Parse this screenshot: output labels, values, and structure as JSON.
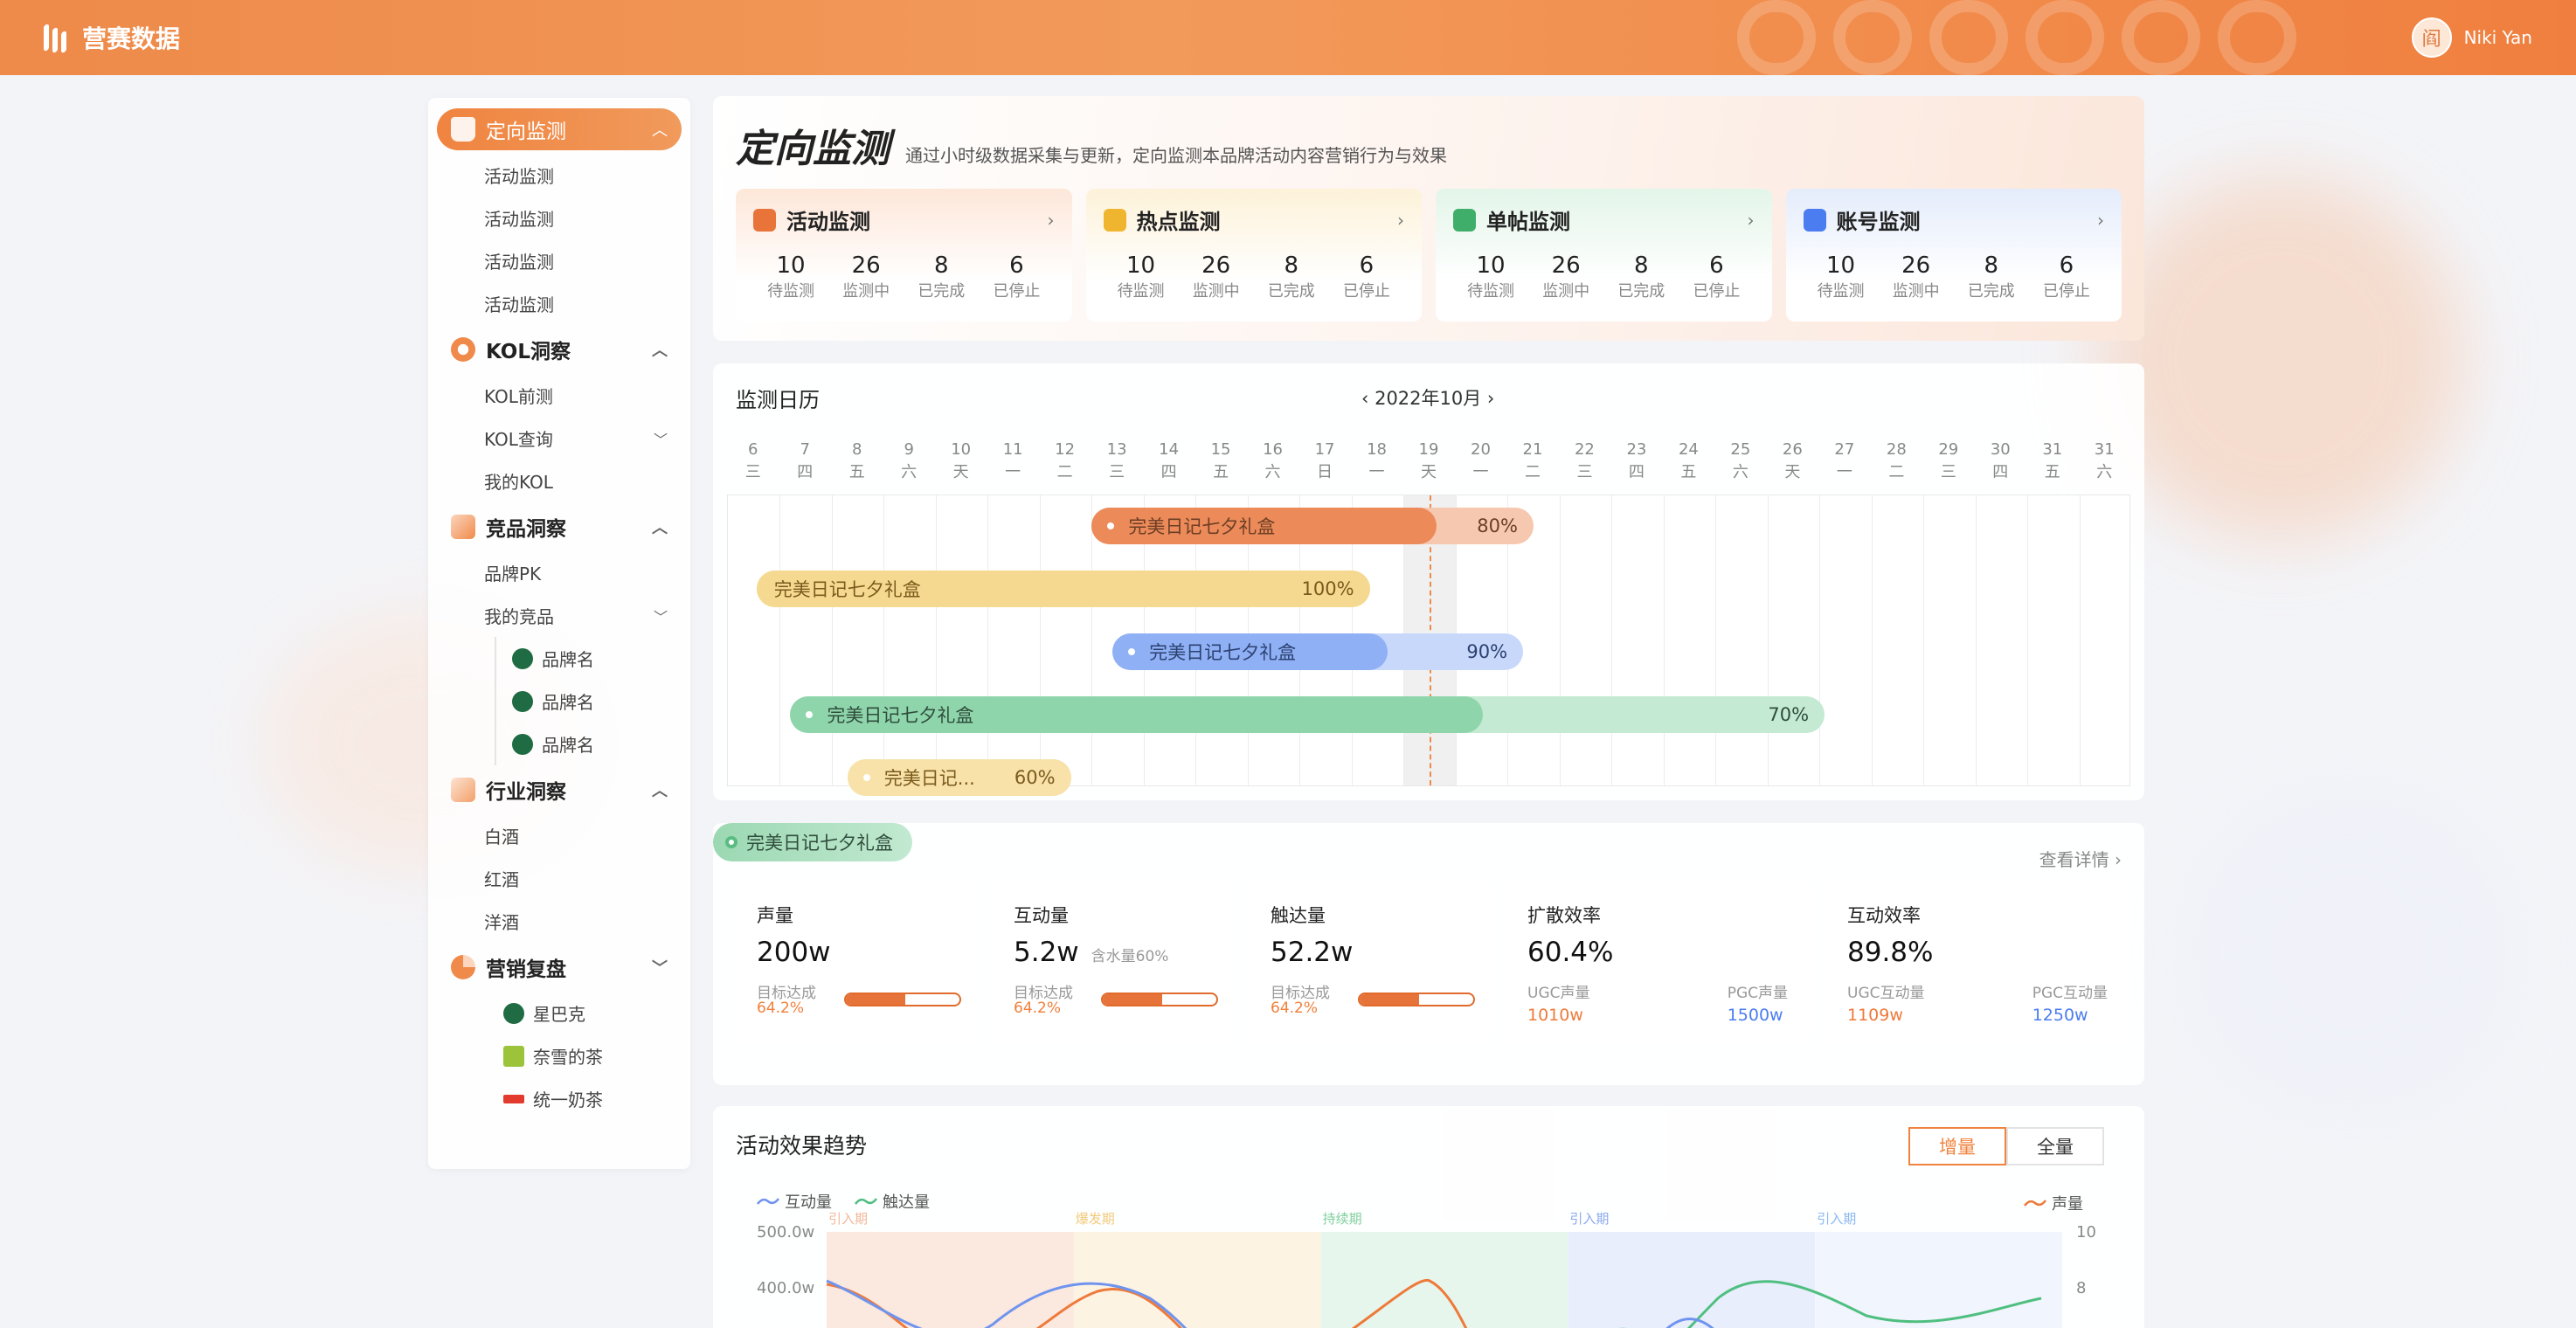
{
  "app": {
    "name": "营赛数据",
    "user": "Niki Yan",
    "avatar_char": "阎"
  },
  "sidebar": {
    "groups": [
      {
        "label": "定向监测",
        "active": true,
        "items": [
          "活动监测",
          "活动监测",
          "活动监测",
          "活动监测"
        ]
      },
      {
        "label": "KOL洞察",
        "items": [
          "KOL前测",
          "KOL查询",
          "我的KOL"
        ]
      },
      {
        "label": "竞品洞察",
        "items": [
          "品牌PK",
          "我的竞品"
        ],
        "brands": [
          "品牌名",
          "品牌名",
          "品牌名"
        ]
      },
      {
        "label": "行业洞察",
        "items": [
          "白酒",
          "红酒",
          "洋酒"
        ]
      },
      {
        "label": "营销复盘",
        "shops": [
          "星巴克",
          "奈雪的茶",
          "统一奶茶"
        ]
      }
    ]
  },
  "hero": {
    "title": "定向监测",
    "subtitle": "通过小时级数据采集与更新，定向监测本品牌活动内容营销行为与效果",
    "cards": [
      {
        "title": "活动监测",
        "color": "#e8743a",
        "values": [
          "10",
          "26",
          "8",
          "6"
        ]
      },
      {
        "title": "热点监测",
        "color": "#f0b52f",
        "values": [
          "10",
          "26",
          "8",
          "6"
        ]
      },
      {
        "title": "单帖监测",
        "color": "#3fae6a",
        "values": [
          "10",
          "26",
          "8",
          "6"
        ]
      },
      {
        "title": "账号监测",
        "color": "#4b7df0",
        "values": [
          "10",
          "26",
          "8",
          "6"
        ]
      }
    ],
    "labels": [
      "待监测",
      "监测中",
      "已完成",
      "已停止"
    ]
  },
  "calendar": {
    "title": "监测日历",
    "month": "2022年10月",
    "days": [
      {
        "d": "6",
        "w": "三"
      },
      {
        "d": "7",
        "w": "四"
      },
      {
        "d": "8",
        "w": "五"
      },
      {
        "d": "9",
        "w": "六"
      },
      {
        "d": "10",
        "w": "天"
      },
      {
        "d": "11",
        "w": "一"
      },
      {
        "d": "12",
        "w": "二"
      },
      {
        "d": "13",
        "w": "三"
      },
      {
        "d": "14",
        "w": "四"
      },
      {
        "d": "15",
        "w": "五"
      },
      {
        "d": "16",
        "w": "六"
      },
      {
        "d": "17",
        "w": "日"
      },
      {
        "d": "18",
        "w": "一"
      },
      {
        "d": "19",
        "w": "天"
      },
      {
        "d": "20",
        "w": "一"
      },
      {
        "d": "21",
        "w": "二"
      },
      {
        "d": "22",
        "w": "三"
      },
      {
        "d": "23",
        "w": "四"
      },
      {
        "d": "24",
        "w": "五"
      },
      {
        "d": "25",
        "w": "六"
      },
      {
        "d": "26",
        "w": "天"
      },
      {
        "d": "27",
        "w": "一"
      },
      {
        "d": "28",
        "w": "二"
      },
      {
        "d": "29",
        "w": "三"
      },
      {
        "d": "30",
        "w": "四"
      },
      {
        "d": "31",
        "w": "五"
      },
      {
        "d": "31",
        "w": "六"
      }
    ],
    "bars": [
      {
        "label": "完美日记七夕礼盒",
        "pct": "80%",
        "dot": true,
        "color": "#ec8a5a",
        "light": "#f6c8b0",
        "text": "#6b3e24"
      },
      {
        "label": "完美日记七夕礼盒",
        "pct": "100%",
        "dot": false,
        "color": "#f6d990",
        "light": "#f6d990",
        "text": "#7a5a1c"
      },
      {
        "label": "完美日记七夕礼盒",
        "pct": "90%",
        "dot": true,
        "color": "#8fb0f5",
        "light": "#c8d8fb",
        "text": "#2c4170"
      },
      {
        "label": "完美日记七夕礼盒",
        "pct": "70%",
        "dot": true,
        "color": "#8fd5ab",
        "light": "#c4ead3",
        "text": "#2f4d3c"
      },
      {
        "label": "完美日记...",
        "pct": "60%",
        "dot": true,
        "color": "#f8e2a9",
        "light": "#f8e2a9",
        "text": "#7a5a1c"
      }
    ]
  },
  "detail": {
    "tag": "完美日记七夕礼盒",
    "link": "查看详情 ›",
    "target_label": "目标达成",
    "metrics": [
      {
        "title": "声量",
        "value": "200w",
        "pct": "64.2%",
        "progress": 0.52
      },
      {
        "title": "互动量",
        "value": "5.2w",
        "note": "含水量60%",
        "pct": "64.2%",
        "progress": 0.52
      },
      {
        "title": "触达量",
        "value": "52.2w",
        "pct": "64.2%",
        "progress": 0.52
      },
      {
        "title": "扩散效率",
        "value": "60.4%",
        "left_label": "UGC声量",
        "left_val": "1010w",
        "right_label": "PGC声量",
        "right_val": "1500w"
      },
      {
        "title": "互动效率",
        "value": "89.8%",
        "left_label": "UGC互动量",
        "left_val": "1109w",
        "right_label": "PGC互动量",
        "right_val": "1250w"
      }
    ]
  },
  "trend": {
    "title": "活动效果趋势",
    "toggle": [
      "增量",
      "全量"
    ],
    "legend": [
      "互动量",
      "触达量"
    ],
    "legend_right": "声量",
    "y_ticks_left": [
      "500.0w",
      "400.0w"
    ],
    "y_ticks_right": [
      "10",
      "8"
    ],
    "phases": [
      {
        "label": "引入期",
        "color": "#f3b79a",
        "bg": "#fbe8df"
      },
      {
        "label": "爆发期",
        "color": "#f2c97a",
        "bg": "#fdf3e2"
      },
      {
        "label": "持续期",
        "color": "#7fcf9d",
        "bg": "#e6f6ec"
      },
      {
        "label": "引入期",
        "color": "#8aa8f0",
        "bg": "#e8eefc"
      },
      {
        "label": "引入期",
        "color": "#8ab8f0",
        "bg": "#f1f5fd"
      }
    ]
  }
}
